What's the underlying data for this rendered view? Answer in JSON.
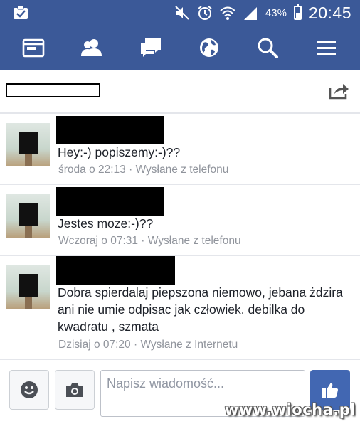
{
  "status_bar": {
    "battery_percent": "43%",
    "clock": "20:45",
    "icons": [
      "clipboard-check-icon",
      "mute-icon",
      "alarm-icon",
      "wifi-icon",
      "signal-icon",
      "battery-icon"
    ],
    "battery_level": 0.43
  },
  "navbar": {
    "items": [
      "news-feed-icon",
      "friends-icon",
      "messages-icon",
      "globe-icon",
      "search-icon",
      "menu-icon"
    ],
    "bg_color": "#3b5998"
  },
  "header": {
    "share_icon": "share-icon"
  },
  "messages": [
    {
      "text": "Hey:-) popiszemy:-)??",
      "meta": "środa o 22:13 · Wysłane z telefonu"
    },
    {
      "text": "Jestes moze:-)??",
      "meta": "Wczoraj o 07:31 · Wysłane z telefonu"
    },
    {
      "text": "Dobra spierdalaj piepszona niemowo, jebana żdzira ani nie umie odpisac jak człowiek. debilka do kwadratu , szmata",
      "meta": "Dzisiaj o 07:20 · Wysłane z Internetu"
    }
  ],
  "compose": {
    "placeholder": "Napisz wiadomość...",
    "value": "",
    "emoji_icon": "smiley-icon",
    "camera_icon": "camera-icon",
    "like_icon": "thumbs-up-icon",
    "like_color": "#4267b2"
  },
  "watermark": "www.wiocha.pl"
}
